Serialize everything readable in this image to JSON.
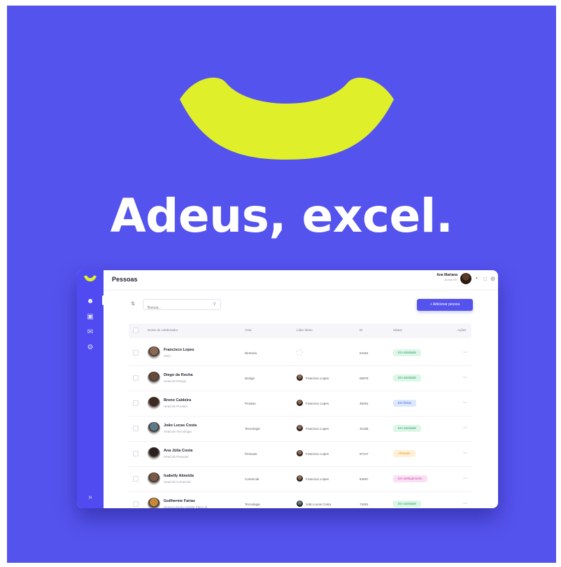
{
  "headline": "Adeus, excel.",
  "colors": {
    "background": "#5553ee",
    "smile": "#dff02a",
    "primary": "#5553ee",
    "badge_green_bg": "#dcf7e8",
    "badge_green_text": "#2e9e62",
    "badge_blue_bg": "#dde7ff",
    "badge_blue_text": "#3a62d8",
    "badge_orange_bg": "#fff0d6",
    "badge_orange_text": "#e09a2a",
    "badge_pink_bg": "#fbe0f4",
    "badge_pink_text": "#c94aa9"
  },
  "app": {
    "page_title": "Pessoas",
    "user": {
      "name": "Ana Mariana",
      "role": "Admin RH"
    },
    "sidebar": {
      "icons": [
        "user-icon",
        "calendar-icon",
        "chat-icon",
        "settings-icon"
      ],
      "collapse_icon": "chevron-right-icon"
    },
    "toolbar": {
      "filter_icon": "filter-icon",
      "search_placeholder": "Buscar...",
      "add_button": "+ Adicionar pessoa"
    },
    "table": {
      "columns": [
        "Nome do colaborador",
        "Área",
        "Líder direto",
        "ID",
        "Status",
        "Ações"
      ],
      "rows": [
        {
          "name": "Francisco Lopes",
          "role": "CEO",
          "area": "Diretoria",
          "leader": "",
          "id": "64181",
          "status": "Em atividade",
          "status_kind": "green"
        },
        {
          "name": "Diego da Rocha",
          "role": "Head de Design",
          "area": "Design",
          "leader": "Francisco Lopes",
          "id": "55978",
          "status": "Em atividade",
          "status_kind": "green"
        },
        {
          "name": "Breno Caldeira",
          "role": "Head de Produto",
          "area": "Produto",
          "leader": "Francisco Lopes",
          "id": "35491",
          "status": "Em férias",
          "status_kind": "blue"
        },
        {
          "name": "João Lucas Costa",
          "role": "Head de Tecnologia",
          "area": "Tecnologia",
          "leader": "Francisco Lopes",
          "id": "31336",
          "status": "Em atividade",
          "status_kind": "green"
        },
        {
          "name": "Ana Júlia Costa",
          "role": "Head de Pessoas",
          "area": "Pessoas",
          "leader": "Francisco Lopes",
          "id": "97147",
          "status": "Afastado",
          "status_kind": "orange"
        },
        {
          "name": "Isabelly Almeida",
          "role": "Head de Comercial",
          "area": "Comercial",
          "leader": "Francisco Lopes",
          "id": "84097",
          "status": "Em desligamento",
          "status_kind": "pink"
        },
        {
          "name": "Guilherme Farias",
          "role": "Desenvolvedor Mobile Pleno III",
          "area": "Tecnologia",
          "leader": "João Lucas Costa",
          "id": "74481",
          "status": "Em atividade",
          "status_kind": "green"
        }
      ]
    }
  }
}
